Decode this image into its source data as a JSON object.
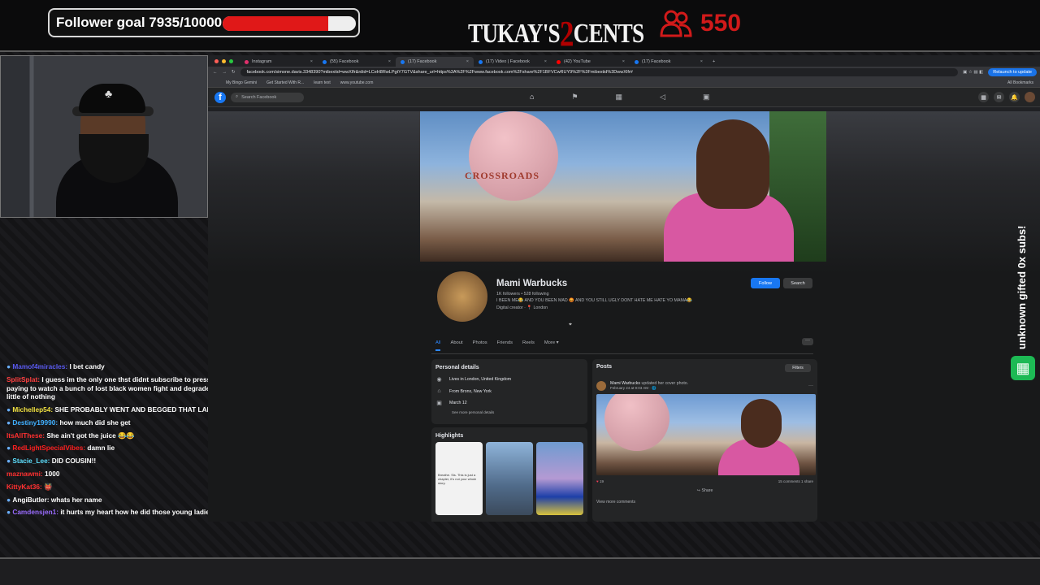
{
  "overlay": {
    "goal_label": "Follower goal 7935/10000",
    "goal_progress": 0.7935,
    "brand_left": "TUKAY'S",
    "brand_num": "2",
    "brand_right": "CENTS",
    "viewer_count": "550",
    "subs_text": "unknown gifted 0x subs!",
    "colors": {
      "accent_red": "#e01818",
      "fb_blue": "#1877f2"
    }
  },
  "chat": [
    {
      "name": "Mamof4miracles:",
      "text": "I bet candy",
      "color": "#5a5af0",
      "badge": "●"
    },
    {
      "name": "SplitSplat:",
      "text": "I guess im the only one thst didnt subscribe to pressure TV. Im not paying to watch a bunch of lost black women fight and degrade eachother for a little of nothing",
      "color": "#ff4040",
      "badge": ""
    },
    {
      "name": "Michellep54:",
      "text": "SHE PROBABLY WENT AND BEGGED THAT LADY",
      "color": "#f0e040",
      "badge": "●"
    },
    {
      "name": "Destiny19990:",
      "text": "how much did she get",
      "color": "#40b0ff",
      "badge": "●"
    },
    {
      "name": "ItsAllThese:",
      "text": "She ain't got the juice 😂😂",
      "color": "#ff3030",
      "badge": ""
    },
    {
      "name": "RedLightSpecialVibes:",
      "text": "damn lie",
      "color": "#ff2020",
      "badge": "●"
    },
    {
      "name": "Stacie_Lee:",
      "text": "DID COUSIN!!",
      "color": "#5ee0ff",
      "badge": "●"
    },
    {
      "name": "maznawmi:",
      "text": "1000",
      "color": "#ff3030",
      "badge": ""
    },
    {
      "name": "KittyKat36:",
      "text": "👹",
      "color": "#ff3030",
      "badge": ""
    },
    {
      "name": "AngiButler:",
      "text": "whats her name",
      "color": "#ffffff",
      "badge": "●"
    },
    {
      "name": "Camdensjen1:",
      "text": "it hurts my heart how he did those young ladies",
      "color": "#9a6cff",
      "badge": "●"
    }
  ],
  "browser": {
    "tabs": [
      "Instagram",
      "(55) Facebook",
      "(17) Facebook",
      "(17) Video | Facebook",
      "(42) YouTube",
      "(17) Facebook"
    ],
    "url": "facebook.com/simone.davis.3348390?mibextid=wwXIfr&rdid=LCeH8RwLPgtY7GTV&share_url=https%3A%2F%2Fwww.facebook.com%2Fshare%2F1BFVCwRUY9%2F%3Fmibextid%3DwwXIfr#",
    "relaunch": "Relaunch to update",
    "bookmarks": [
      "My Bingo Gemini",
      "Get Started With R...",
      "learn text",
      "www.youtube.com"
    ],
    "all_bookmarks": "All Bookmarks"
  },
  "facebook": {
    "search_placeholder": "Search Facebook",
    "profile": {
      "name": "Mami Warbucks",
      "stats": "1K followers • 528 following",
      "bio": "I BEEN ME😂 AND YOU BEEN MAD 😡 AND YOU STILL UGLY DONT HATE ME HATE YO MAMA😂",
      "meta": "Digital creator · 📍 London",
      "follow": "Follow",
      "search": "Search"
    },
    "tabs": [
      "All",
      "About",
      "Photos",
      "Friends",
      "Reels",
      "More ▾"
    ],
    "details_title": "Personal details",
    "details": [
      {
        "icon": "⌂",
        "text": "Lives in London, United Kingdom"
      },
      {
        "icon": "⌂",
        "text": "From Bronx, New York"
      },
      {
        "icon": "▣",
        "text": "March 12"
      }
    ],
    "see_more": "See more personal details",
    "highlights_title": "Highlights",
    "highlight1_text": "Breathe. Sis. This is just a chapter, it's not your whole story.",
    "posts_title": "Posts",
    "filters": "Filters",
    "post": {
      "author": "Mami Warbucks",
      "action": "updated her cover photo.",
      "when": "February 24 at 9:03 AM · 🌐",
      "reactions": "19",
      "counts": "15 comments   1 share",
      "share": "Share",
      "view_more": "View more comments"
    }
  }
}
